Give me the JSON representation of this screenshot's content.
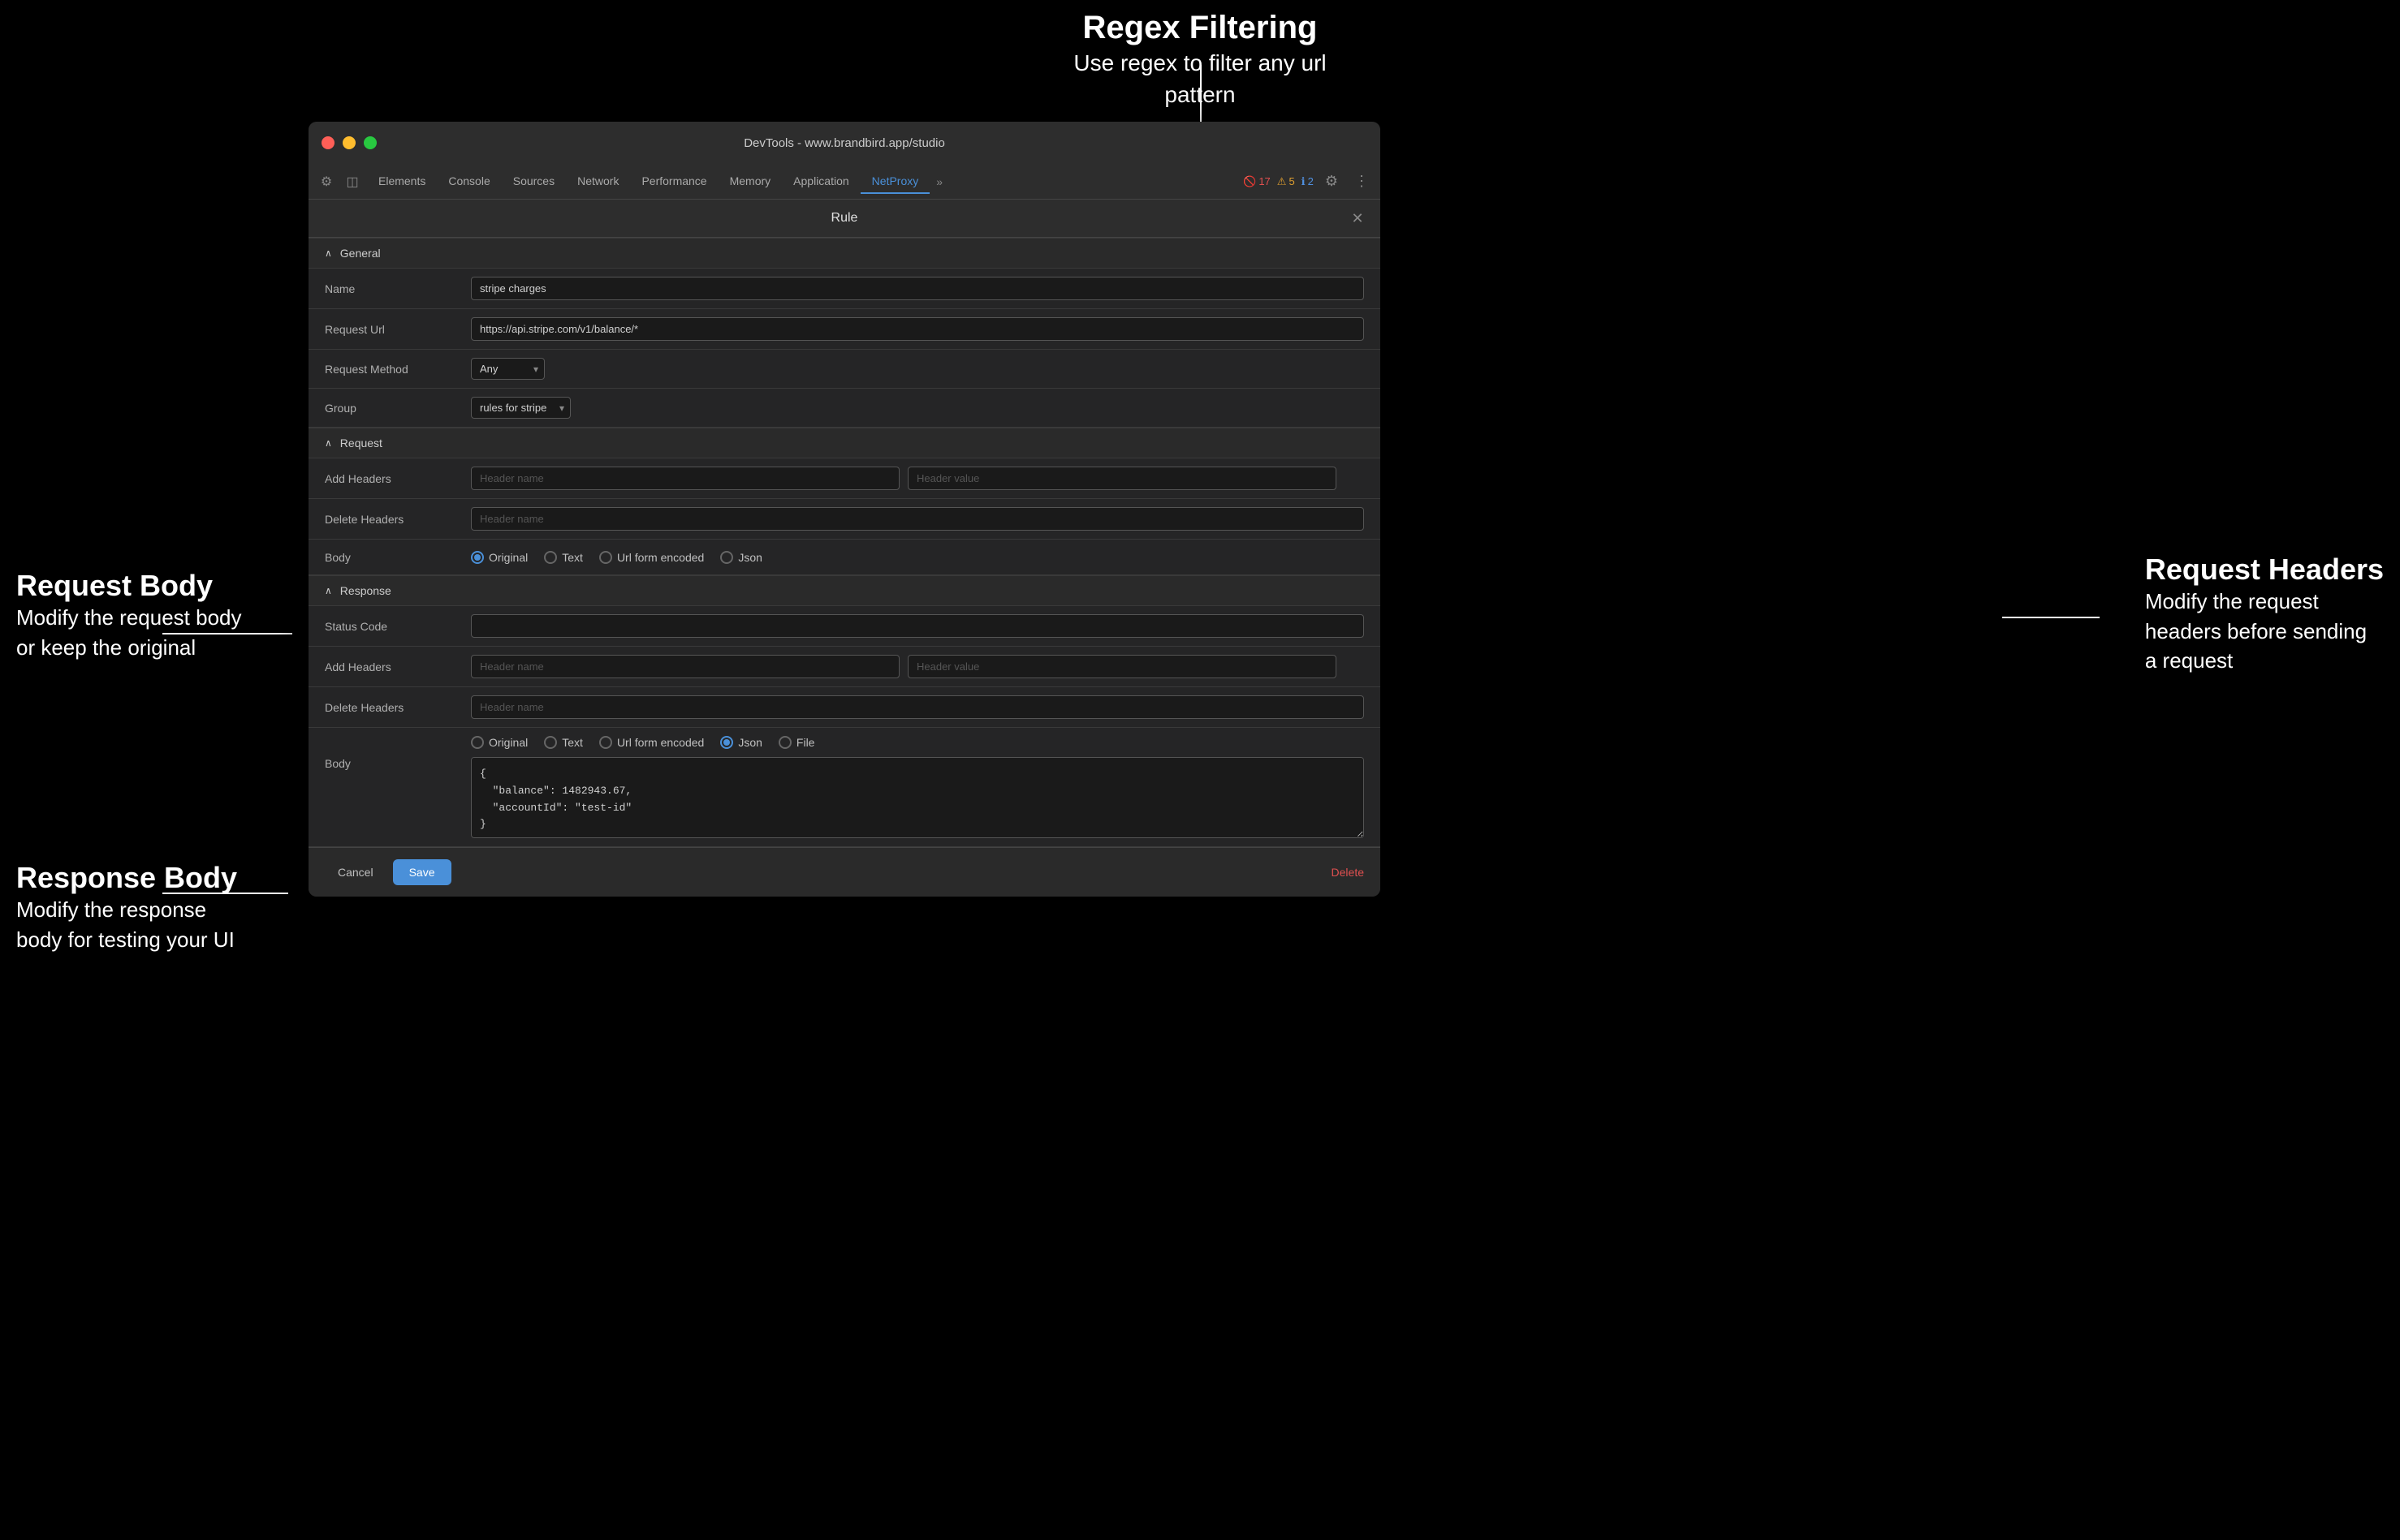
{
  "annotations": {
    "regex_title": "Regex Filtering",
    "regex_desc": "Use regex to filter any url pattern",
    "request_body_title": "Request Body",
    "request_body_desc": "Modify the request body or keep the original",
    "request_headers_title": "Request Headers",
    "request_headers_desc": "Modify the request headers before sending a request",
    "response_body_title": "Response Body",
    "response_body_desc": "Modify the response body for testing your UI"
  },
  "titlebar": {
    "title": "DevTools - www.brandbird.app/studio"
  },
  "tabs": [
    {
      "label": "Elements",
      "active": false
    },
    {
      "label": "Console",
      "active": false
    },
    {
      "label": "Sources",
      "active": false
    },
    {
      "label": "Network",
      "active": false
    },
    {
      "label": "Performance",
      "active": false
    },
    {
      "label": "Memory",
      "active": false
    },
    {
      "label": "Application",
      "active": false
    },
    {
      "label": "NetProxy",
      "active": true
    }
  ],
  "badges": {
    "errors": "17",
    "warnings": "5",
    "info": "2"
  },
  "modal": {
    "title": "Rule",
    "general_section": "General",
    "request_section": "Request",
    "response_section": "Response",
    "name_label": "Name",
    "name_value": "stripe charges",
    "request_url_label": "Request Url",
    "request_url_value": "https://api.stripe.com/v1/balance/*",
    "request_method_label": "Request Method",
    "request_method_value": "Any",
    "group_label": "Group",
    "group_value": "rules for stripe",
    "add_headers_label": "Add Headers",
    "delete_headers_label": "Delete Headers",
    "body_label": "Body",
    "header_name_placeholder": "Header name",
    "header_value_placeholder": "Header value",
    "request_body_options": [
      {
        "label": "Original",
        "selected": true
      },
      {
        "label": "Text",
        "selected": false
      },
      {
        "label": "Url form encoded",
        "selected": false
      },
      {
        "label": "Json",
        "selected": false
      }
    ],
    "response_body_options": [
      {
        "label": "Original",
        "selected": false
      },
      {
        "label": "Text",
        "selected": false
      },
      {
        "label": "Url form encoded",
        "selected": false
      },
      {
        "label": "Json",
        "selected": true
      },
      {
        "label": "File",
        "selected": false
      }
    ],
    "status_code_label": "Status Code",
    "status_code_placeholder": "",
    "json_body": "{\n  \"balance\": 1482943.67,\n  \"accountId\": \"test-id\"\n}",
    "cancel_label": "Cancel",
    "save_label": "Save",
    "delete_label": "Delete"
  }
}
